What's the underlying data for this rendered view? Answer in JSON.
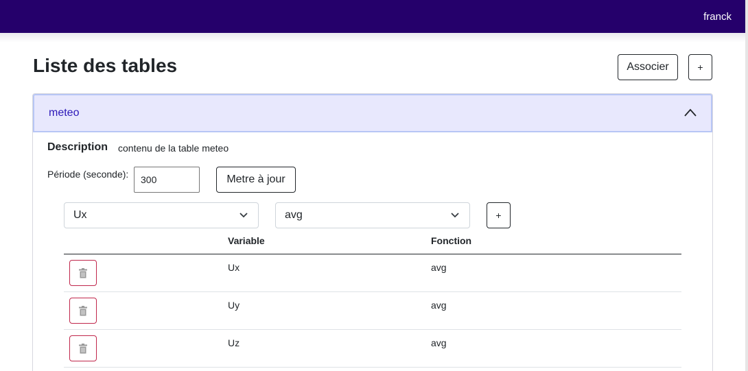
{
  "navbar": {
    "user": "franck",
    "bg_color": "#25006b"
  },
  "page": {
    "title": "Liste des tables",
    "associate_label": "Associer",
    "add_table_label": "+"
  },
  "accordion": {
    "title": "meteo",
    "expanded": true,
    "description_label": "Description",
    "description_value": "contenu de la table meteo",
    "period_label": "Période (seconde):",
    "period_value": "300",
    "update_label": "Metre à jour",
    "variable_select": "Ux",
    "function_select": "avg",
    "add_row_label": "+",
    "columns": [
      "Variable",
      "Fonction"
    ],
    "rows": [
      {
        "variable": "Ux",
        "function": "avg"
      },
      {
        "variable": "Uy",
        "function": "avg"
      },
      {
        "variable": "Uz",
        "function": "avg"
      }
    ]
  },
  "icons": {
    "delete": "trash-icon",
    "collapse": "chevron-up-icon",
    "dropdown": "chevron-down-icon"
  },
  "colors": {
    "accent": "#2b17b8",
    "danger": "#c0254a",
    "header_bg": "#e8e8fd"
  }
}
